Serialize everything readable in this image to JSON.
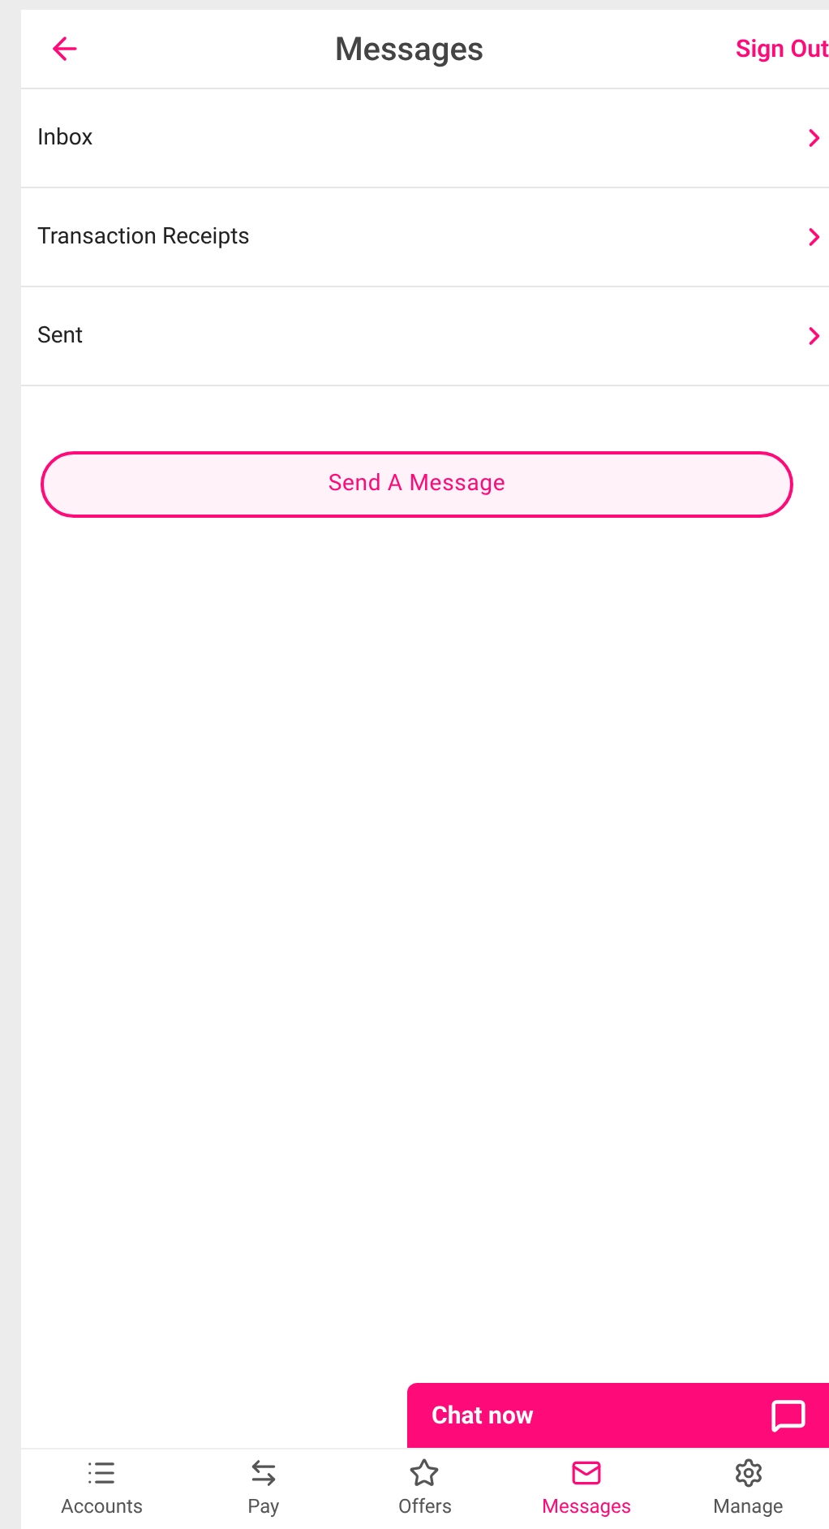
{
  "header": {
    "title": "Messages",
    "action": "Sign Out"
  },
  "menu": [
    {
      "label": "Inbox"
    },
    {
      "label": "Transaction Receipts"
    },
    {
      "label": "Sent"
    }
  ],
  "primary_button": "Send A Message",
  "chat": {
    "label": "Chat now"
  },
  "tabs": [
    {
      "label": "Accounts",
      "kind": "list",
      "selected": false
    },
    {
      "label": "Pay",
      "kind": "transfer",
      "selected": false
    },
    {
      "label": "Offers",
      "kind": "star",
      "selected": false
    },
    {
      "label": "Messages",
      "kind": "mail",
      "selected": true
    },
    {
      "label": "Manage",
      "kind": "gear",
      "selected": false
    }
  ]
}
